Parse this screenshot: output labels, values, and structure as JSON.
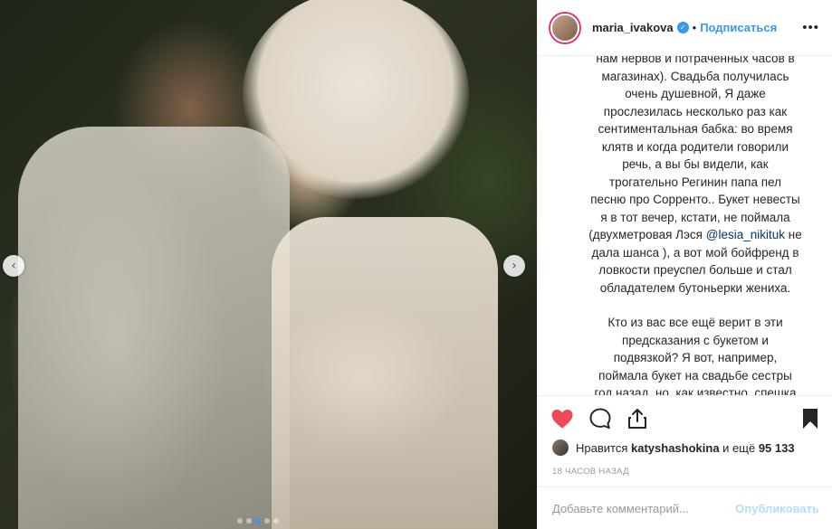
{
  "photo": {
    "alt_icons": {
      "prev": "chevron-left-icon",
      "next": "chevron-right-icon"
    },
    "carousel_total": 5,
    "carousel_active_index": 2
  },
  "header": {
    "username": "maria_ivakova",
    "verified_icon": "verified-badge-icon",
    "separator": "•",
    "follow_label": "Подписаться",
    "more_icon": "more-options-icon"
  },
  "caption": {
    "para1": "нам нервов и потраченных часов в\nмагазинах). Свадьба получилась\nочень душевной, Я даже\nпрослезилась несколько раз как\nсентиментальная бабка: во время\nклятв и когда родители говорили\nречь, а вы бы видели, как\nтрогательно Регинин папа пел\nпесню про Сорренто.. Букет невесты\nя в тот вечер, кстати, не поймала\n(двухметровая Лэся ",
    "mention": "@lesia_nikituk",
    "para1_end": " не\nдала шанса ), а вот мой бойфренд в\nловкости преуспел больше и стал\nобладателем бутоньерки жениха.",
    "para2": "Кто из вас все ещё верит в эти\nпредсказания с букетом и\nподвязкой? Я вот, например,\nпоймала букет на свадьбе сестры\nгод назад, но, как известно, спешка\nхороша при ловле блох, а не мужей"
  },
  "actions": {
    "like_icon": "heart-icon",
    "comment_icon": "comment-icon",
    "share_icon": "share-icon",
    "save_icon": "bookmark-icon",
    "liked": true,
    "saved": true
  },
  "likes": {
    "prefix": "Нравится",
    "user": "katyshashokina",
    "conj": "и ещё",
    "count": "95 133"
  },
  "timestamp": "18 ЧАСОВ НАЗАД",
  "comment": {
    "placeholder": "Добавьте комментарий...",
    "publish_label": "Опубликовать"
  },
  "colors": {
    "accent": "#3897f0",
    "like_red": "#ed4956",
    "publish_disabled": "#b2dffc"
  }
}
